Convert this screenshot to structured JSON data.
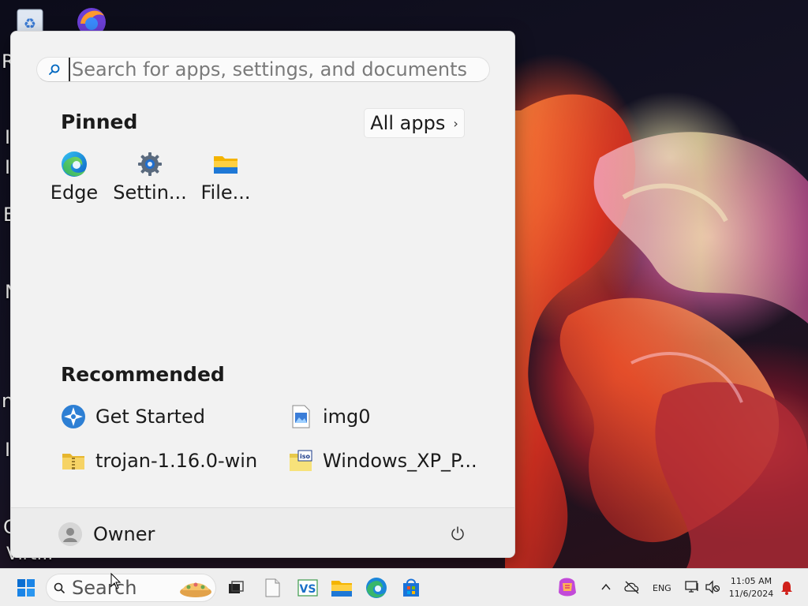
{
  "desktop": {
    "partial_labels": [
      "R",
      "I",
      "I",
      "E",
      "N",
      "n",
      "I",
      "C",
      "Virt..."
    ]
  },
  "start_menu": {
    "search": {
      "placeholder": "Search for apps, settings, and documents",
      "value": ""
    },
    "pinned": {
      "title": "Pinned",
      "all_apps_label": "All apps",
      "apps": [
        {
          "label": "Edge",
          "icon": "edge-icon"
        },
        {
          "label": "Settin...",
          "icon": "gear-icon"
        },
        {
          "label": "File...",
          "icon": "folder-icon"
        }
      ]
    },
    "recommended": {
      "title": "Recommended",
      "items": [
        {
          "label": "Get Started",
          "icon": "get-started-icon"
        },
        {
          "label": "img0",
          "icon": "image-file-icon"
        },
        {
          "label": "trojan-1.16.0-win",
          "icon": "zip-folder-icon"
        },
        {
          "label": "Windows_XP_P...",
          "icon": "iso-file-icon"
        }
      ]
    },
    "user": {
      "name": "Owner"
    }
  },
  "taskbar": {
    "search_label": "Search",
    "language": "ENG",
    "clock_time": "11:05 AM",
    "clock_date": "11/6/2024"
  },
  "colors": {
    "accent": "#0067c0",
    "menu_bg": "#f2f2f2",
    "taskbar_bg": "#eeeeee"
  }
}
